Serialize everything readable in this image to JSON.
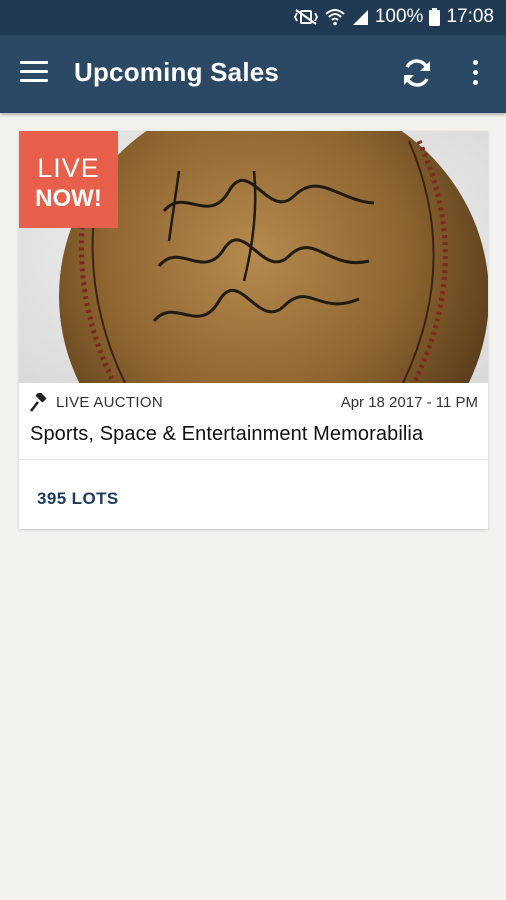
{
  "status_bar": {
    "battery": "100%",
    "time": "17:08"
  },
  "app_bar": {
    "title": "Upcoming Sales",
    "icons": [
      "menu-icon",
      "refresh-icon",
      "more-vert-icon"
    ]
  },
  "sale": {
    "badge_line1": "LIVE",
    "badge_line2": "NOW!",
    "type": "LIVE AUCTION",
    "date": "Apr 18 2017 - 11 PM",
    "title": "Sports, Space & Entertainment Memorabilia",
    "lots": "395 LOTS",
    "image": "signed-baseball-image"
  },
  "colors": {
    "status_bar": "#213a53",
    "app_bar": "#2b4865",
    "badge": "#e8604c",
    "lots_text": "#1d3a5f",
    "background": "#f3f2ee"
  }
}
